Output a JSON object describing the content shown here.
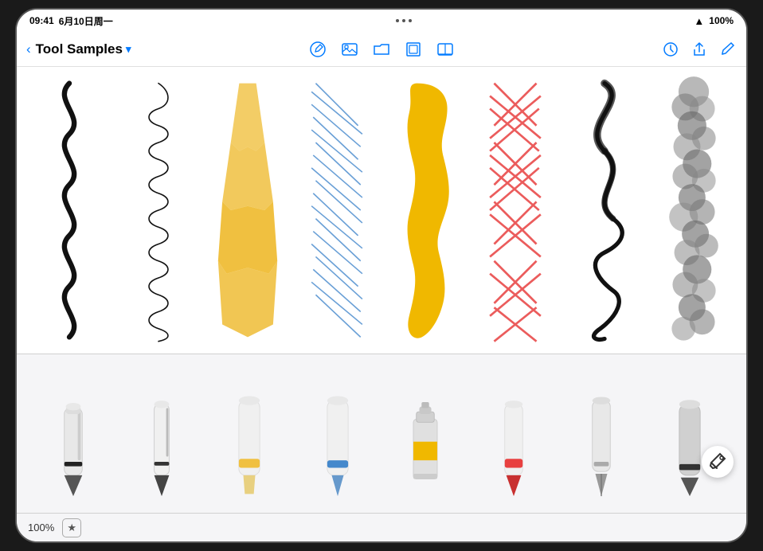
{
  "status": {
    "time": "09:41",
    "date": "6月10日周一",
    "wifi": "WiFi",
    "battery": "100%",
    "dots": [
      "•",
      "•",
      "•"
    ]
  },
  "header": {
    "back_label": "‹",
    "title": "Tool Samples",
    "dropdown_icon": "▾",
    "toolbar_icons": [
      "circle_pencil",
      "square",
      "folder",
      "frame",
      "image"
    ],
    "right_icons": [
      "clock",
      "share",
      "edit"
    ]
  },
  "canvas": {
    "strokes": [
      {
        "id": "ink_pen",
        "color": "black",
        "style": "wavy_snake"
      },
      {
        "id": "fine_liner",
        "color": "black",
        "style": "loop_swirl"
      },
      {
        "id": "marker_yellow",
        "color": "#f0c040",
        "style": "ribbon"
      },
      {
        "id": "pencil_blue",
        "color": "#4488cc",
        "style": "scribble"
      },
      {
        "id": "paint_yellow",
        "color": "#f0b800",
        "style": "blob"
      },
      {
        "id": "crayon_red",
        "color": "#e84040",
        "style": "crosshatch"
      },
      {
        "id": "calligraphy",
        "color": "black",
        "style": "flourish"
      },
      {
        "id": "watercolor",
        "color": "#555",
        "style": "cloud_dots"
      }
    ]
  },
  "tools": [
    {
      "id": "ink_pen",
      "label": "Ink Pen",
      "color": "#222",
      "accent": "#222"
    },
    {
      "id": "fine_liner",
      "label": "Fine Liner",
      "color": "#333",
      "accent": "#333"
    },
    {
      "id": "marker_yellow",
      "label": "Marker",
      "color": "#f0c040",
      "accent": "#f0c040"
    },
    {
      "id": "marker_blue",
      "label": "Marker Blue",
      "color": "#4488cc",
      "accent": "#4488cc"
    },
    {
      "id": "paint_tube",
      "label": "Paint",
      "color": "#f0b800",
      "accent": "#f0b800"
    },
    {
      "id": "crayon_red",
      "label": "Crayon",
      "color": "#e84040",
      "accent": "#e84040"
    },
    {
      "id": "nib_pen",
      "label": "Nib Pen",
      "color": "#222",
      "accent": "#222"
    },
    {
      "id": "charcoal",
      "label": "Charcoal",
      "color": "#555",
      "accent": "#555"
    }
  ],
  "bottomBar": {
    "zoom": "100%",
    "favorite_icon": "★"
  }
}
